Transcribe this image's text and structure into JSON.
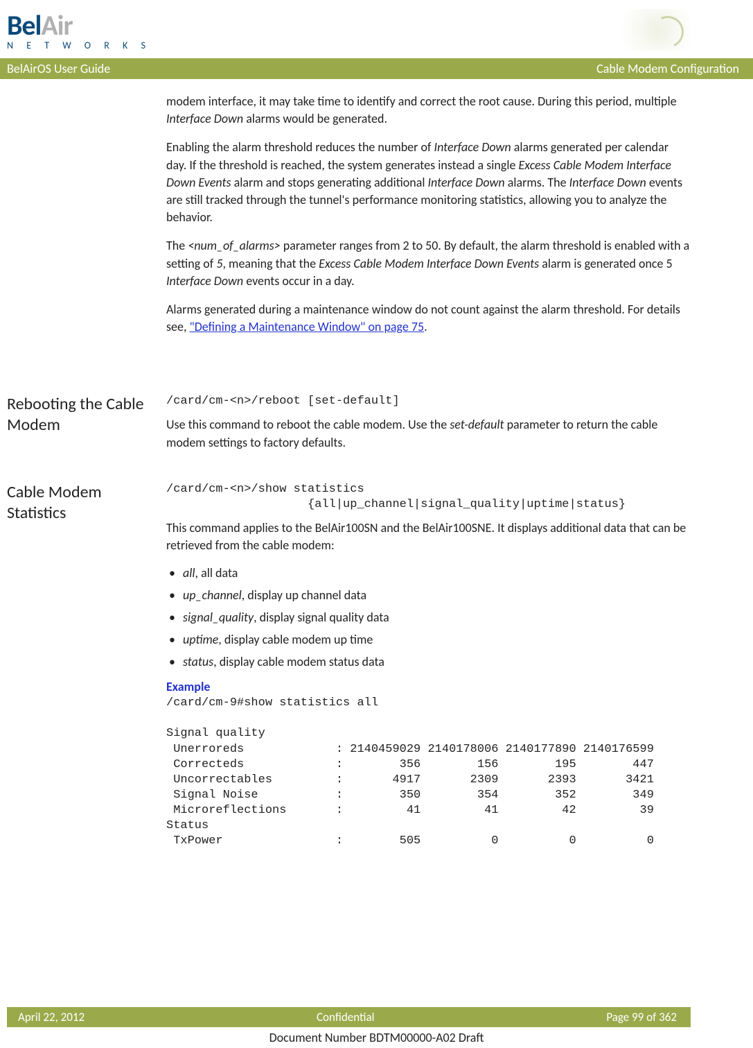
{
  "header": {
    "logo_line1_a": "Bel",
    "logo_line1_b": "Air",
    "logo_line2": "N E T W O R K S",
    "bar_left": "BelAirOS User Guide",
    "bar_right": "Cable Modem Configuration"
  },
  "intro": {
    "p1a": "modem interface, it may take time to identify and correct the root cause. During this period, multiple ",
    "p1_it1": "Interface Down",
    "p1b": " alarms would be generated.",
    "p2a": "Enabling the alarm threshold reduces the number of ",
    "p2_it1": "Interface Down",
    "p2b": " alarms generated per calendar day. If the threshold is reached, the system generates instead a single ",
    "p2_it2": "Excess Cable Modem Interface Down Events",
    "p2c": " alarm and stops generating additional ",
    "p2_it3": "Interface Down",
    "p2d": " alarms. The ",
    "p2_it4": "Interface Down",
    "p2e": " events are still tracked through the tunnel's performance monitoring statistics, allowing you to analyze the behavior.",
    "p3a": "The ",
    "p3_it1": "<num_of_alarms>",
    "p3b": " parameter ranges from 2 to 50. By default, the alarm threshold is enabled with a setting of ",
    "p3_it2": "5",
    "p3c": ", meaning that the ",
    "p3_it3": "Excess Cable Modem Interface Down Events",
    "p3d": " alarm is generated once 5 ",
    "p3_it4": "Interface Down",
    "p3e": " events occur in a day.",
    "p4a": "Alarms generated during a maintenance window do not count against the alarm threshold. For details see, ",
    "p4_link": "\"Defining a Maintenance Window\" on page 75",
    "p4b": "."
  },
  "reboot": {
    "heading": "Rebooting the Cable Modem",
    "cmd": "/card/cm-<n>/reboot [set-default]",
    "p1a": "Use this command to reboot the cable modem. Use the ",
    "p1_it1": "set-default",
    "p1b": " parameter to return the cable modem settings to factory defaults."
  },
  "stats": {
    "heading": "Cable Modem Statistics",
    "cmd": "/card/cm-<n>/show statistics\n                    {all|up_channel|signal_quality|uptime|status}",
    "p1": "This command applies to the BelAir100SN and the BelAir100SNE. It displays additional data that can be retrieved from the cable modem:",
    "opts": [
      {
        "term": "all",
        "desc": ", all data"
      },
      {
        "term": "up_channel",
        "desc": ", display up channel data"
      },
      {
        "term": "signal_quality",
        "desc": ", display signal quality data"
      },
      {
        "term": "uptime",
        "desc": ", display cable modem up time"
      },
      {
        "term": "status",
        "desc": ", display cable modem status data"
      }
    ],
    "example_label": "Example",
    "example": "/card/cm-9#show statistics all\n\nSignal quality\n Unerroreds             : 2140459029 2140178006 2140177890 2140176599\n Correcteds             :        356        156        195        447\n Uncorrectables         :       4917       2309       2393       3421\n Signal Noise           :        350        354        352        349\n Microreflections       :         41         41         42         39\nStatus\n TxPower                :        505          0          0          0"
  },
  "footer": {
    "left": "April 22, 2012",
    "center": "Confidential",
    "right": "Page 99 of 362",
    "docnum": "Document Number BDTM00000-A02 Draft"
  }
}
